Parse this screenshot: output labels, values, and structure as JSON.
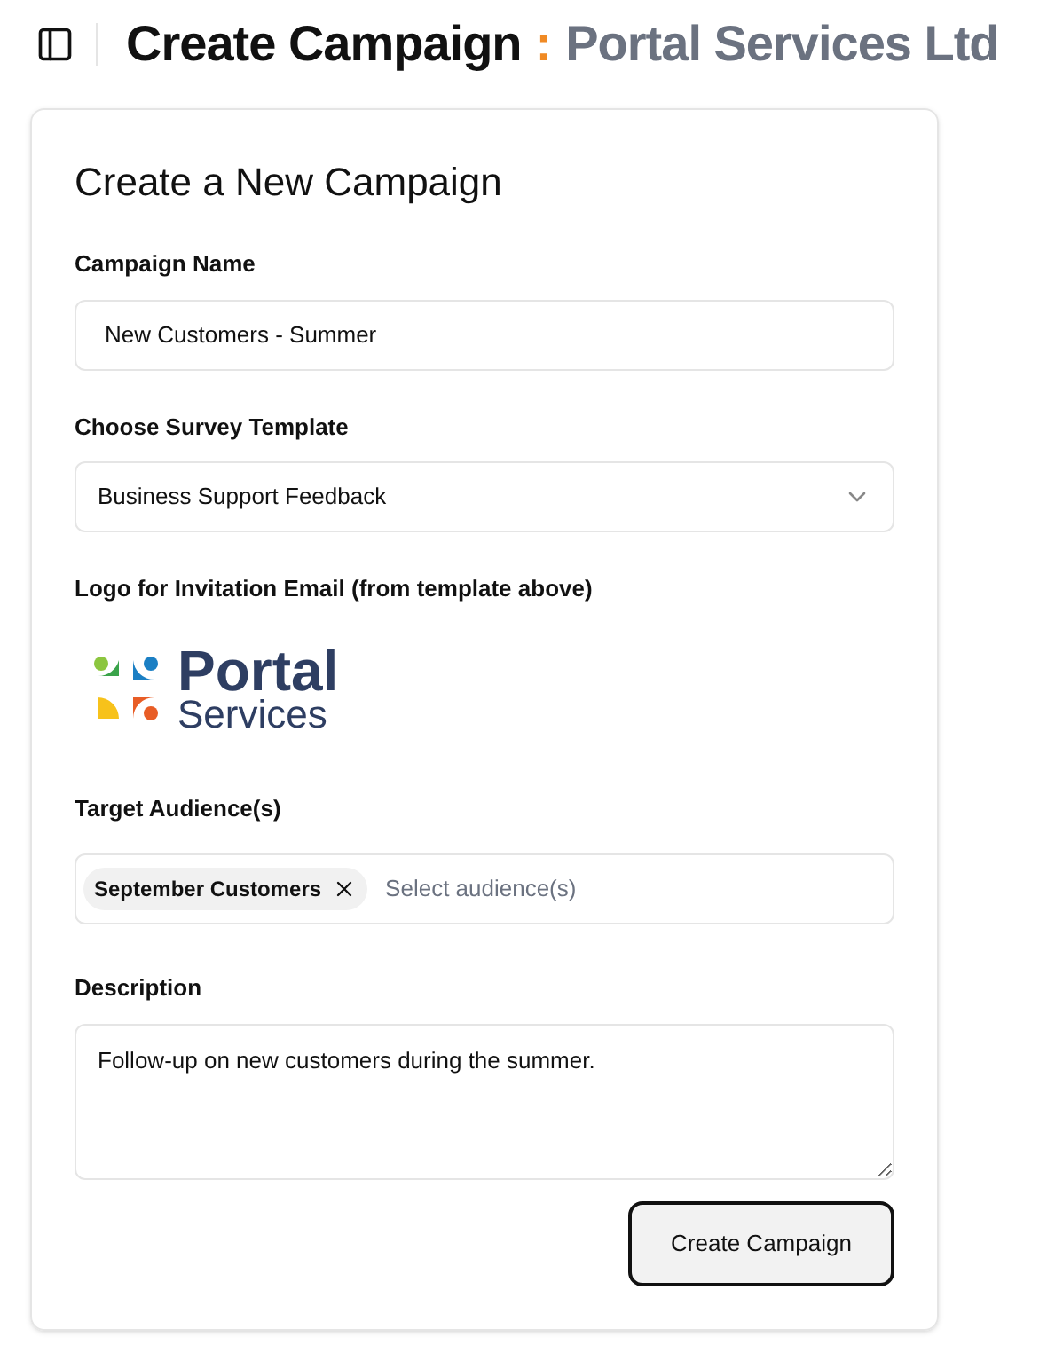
{
  "header": {
    "title": "Create Campaign",
    "separator": ":",
    "subtitle": "Portal Services Ltd"
  },
  "form": {
    "heading": "Create a New Campaign",
    "campaign_name": {
      "label": "Campaign Name",
      "value": "New Customers - Summer"
    },
    "template": {
      "label": "Choose Survey Template",
      "value": "Business Support Feedback"
    },
    "logo": {
      "label": "Logo for Invitation Email (from template above)",
      "line_1": "Portal",
      "line_2": "Services"
    },
    "audience": {
      "label": "Target Audience(s)",
      "chips": [
        "September Customers"
      ],
      "placeholder": "Select audience(s)"
    },
    "description": {
      "label": "Description",
      "value": "Follow-up on new customers during the summer."
    },
    "submit": {
      "label": "Create Campaign",
      "focused": true
    }
  }
}
